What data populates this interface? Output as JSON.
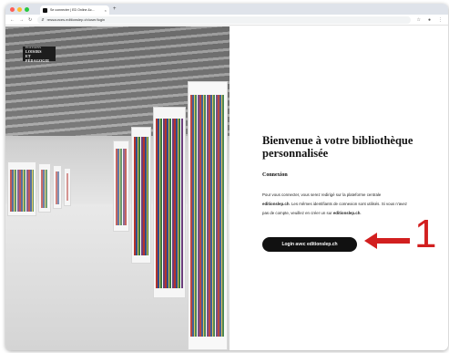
{
  "browser": {
    "tab_title": "Se connecter | ED Online &c...",
    "tab_close": "×",
    "new_tab": "+",
    "url": "ressources.editionslep.ch/user/login"
  },
  "brand": {
    "line1": "ÉDITIONS",
    "line2": "LOISIRS",
    "line3": "ET PÉDAGOGIE"
  },
  "main": {
    "title": "Bienvenue à votre bibliothèque personnalisée",
    "section_title": "Connexion",
    "desc_1": "Pour vous connecter, vous serez redirigé sur la plateforme centrale ",
    "desc_site_1": "editionslep.ch",
    "desc_2": ". Les mêmes identifiants de connexion sont utilisés. Si vous n'avez pas de compte, veuillez en créer un sur ",
    "desc_site_2": "editionslep.ch",
    "desc_3": ".",
    "login_label": "Login avec editionslep.ch"
  },
  "annotation": {
    "number": "1",
    "color": "#d21f1f"
  },
  "icons": [
    "back-icon",
    "forward-icon",
    "reload-icon",
    "lock-icon",
    "star-icon",
    "profile-icon",
    "menu-icon"
  ]
}
